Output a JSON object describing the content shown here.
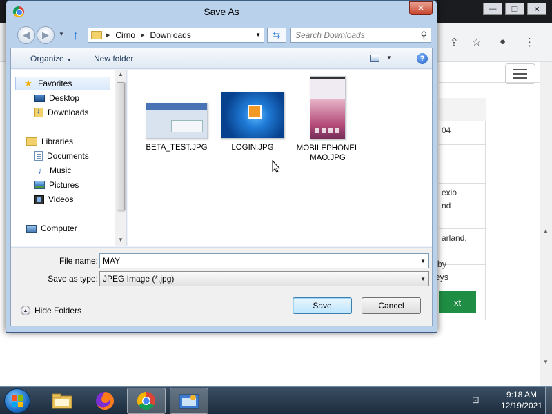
{
  "dialog": {
    "title": "Save As",
    "close_label": "✕"
  },
  "navbar": {
    "back_icon": "back-arrow-icon",
    "forward_icon": "forward-arrow-icon",
    "breadcrumb": [
      "Cirno",
      "Downloads"
    ],
    "search_placeholder": "Search Downloads"
  },
  "command_bar": {
    "organize": "Organize",
    "new_folder": "New folder"
  },
  "sidebar": {
    "favorites": {
      "label": "Favorites"
    },
    "items": [
      {
        "label": "Desktop"
      },
      {
        "label": "Downloads"
      },
      {
        "label": "Libraries"
      },
      {
        "label": "Documents"
      },
      {
        "label": "Music"
      },
      {
        "label": "Pictures"
      },
      {
        "label": "Videos"
      },
      {
        "label": "Computer"
      }
    ]
  },
  "files": [
    {
      "name": "BETA_TEST.JPG"
    },
    {
      "name": "LOGIN.JPG"
    },
    {
      "name": "MOBILEPHONEL\nMAO.JPG"
    }
  ],
  "form": {
    "file_name_label": "File name:",
    "file_name_value": "MAY",
    "save_type_label": "Save as type:",
    "save_type_value": "JPEG Image (*.jpg)",
    "hide_folders": "Hide Folders",
    "save": "Save",
    "cancel": "Cancel"
  },
  "background_page": {
    "rows": [
      "04",
      "exio\nnd",
      "arland,"
    ],
    "next_button": "xt",
    "hint_line1": "th by",
    "hint_line2": "pressing the left/right arrow keys"
  },
  "taskbar": {
    "time": "9:18 AM",
    "date": "12/19/2021"
  }
}
